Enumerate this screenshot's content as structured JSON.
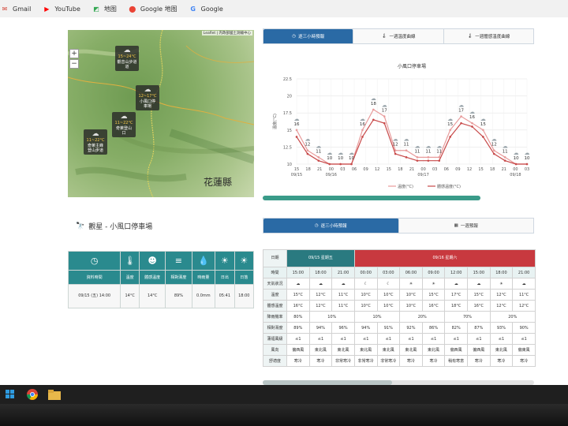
{
  "bookmarks": [
    {
      "label": "Gmail",
      "icon": "gmail-icon"
    },
    {
      "label": "YouTube",
      "icon": "youtube-icon"
    },
    {
      "label": "地图",
      "icon": "maps-icon"
    },
    {
      "label": "Google 地图",
      "icon": "google-maps-pin-icon"
    },
    {
      "label": "Google",
      "icon": "google-g-icon"
    }
  ],
  "map": {
    "attribution": "Leaflet | 内政部國土測繪中心",
    "county_label": "花蓮縣",
    "zoom_in": "+",
    "zoom_out": "−",
    "markers": [
      {
        "temp": "15~24°C",
        "name": "觀音山步道",
        "line3": "道"
      },
      {
        "temp": "12~17°C",
        "name": "小風口停",
        "line3": "車場"
      },
      {
        "temp": "11~22°C",
        "name": "奇萊登山",
        "line3": "口"
      },
      {
        "temp": "11~22°C",
        "name": "奇萊主峰",
        "line3": "登山步道"
      }
    ]
  },
  "chart_tabs": [
    "逐三小時預報",
    "一週溫度曲線",
    "一週體感溫度曲線"
  ],
  "chart_data": {
    "type": "line",
    "title": "小風口停車場",
    "ylabel": "溫度(°C)",
    "ylim": [
      10,
      22.5
    ],
    "y_ticks": [
      "22.5",
      "20",
      "17.5",
      "15",
      "12.5",
      "10"
    ],
    "x_ticks": [
      "15",
      "18",
      "21",
      "00",
      "03",
      "06",
      "09",
      "12",
      "15",
      "18",
      "21",
      "00",
      "03",
      "06",
      "09",
      "12",
      "15",
      "18",
      "21",
      "00",
      "03"
    ],
    "x_dates": [
      "09/15",
      "09/16",
      "09/17",
      "09/18"
    ],
    "legend": [
      "溫度(°C)",
      "體感溫度(°C)"
    ],
    "point_labels": [
      "16",
      "12",
      "11",
      "10",
      "10",
      "10",
      "16",
      "18",
      "17",
      "12",
      "11",
      "11",
      "11",
      "11",
      "15",
      "17",
      "16",
      "15",
      "12",
      "11",
      "10",
      "10"
    ],
    "series": [
      {
        "name": "溫度(°C)",
        "color": "#e89b9b",
        "values": [
          15,
          12,
          11,
          10,
          10,
          10,
          15,
          18,
          17,
          12,
          12,
          11,
          11,
          11,
          15,
          17,
          16,
          15,
          12,
          11,
          10,
          10
        ]
      },
      {
        "name": "體感溫度(°C)",
        "color": "#c84a4a",
        "values": [
          14,
          11.5,
          10.5,
          10,
          10,
          10,
          14,
          16.5,
          16,
          11.5,
          11,
          10.5,
          10.5,
          10.5,
          14,
          16,
          15.5,
          14,
          11.5,
          10.5,
          10,
          10
        ]
      }
    ]
  },
  "station": {
    "title": "觀星 - 小風口停車場",
    "headers": [
      "資料時間",
      "溫度",
      "體感溫度",
      "相對濕度",
      "時雨量",
      "日出",
      "日落"
    ],
    "icons": [
      "clock-icon",
      "thermometer-icon",
      "feel-temp-icon",
      "humidity-icon",
      "raindrop-icon",
      "sunrise-icon",
      "sunset-icon"
    ],
    "values": [
      "09/15 (五) 14:00",
      "14°C",
      "14°C",
      "89%",
      "0.0mm",
      "05:41",
      "18:00"
    ]
  },
  "forecast_tabs": [
    "逐三小時預報",
    "一週預報"
  ],
  "forecast": {
    "date_label": "日期",
    "day1": "09/15 星期五",
    "day2": "09/16 星期六",
    "rows": [
      {
        "label": "時間",
        "cells": [
          "15:00",
          "18:00",
          "21:00",
          "00:00",
          "03:00",
          "06:00",
          "09:00",
          "12:00",
          "15:00",
          "18:00",
          "21:00"
        ]
      },
      {
        "label": "天氣狀況",
        "cells": [
          "cloud",
          "cloud",
          "cloud",
          "moon",
          "moon",
          "sun",
          "sun",
          "cloud",
          "cloud",
          "sun",
          "cloud"
        ]
      },
      {
        "label": "溫度",
        "cells": [
          "15°C",
          "12°C",
          "11°C",
          "10°C",
          "10°C",
          "10°C",
          "15°C",
          "17°C",
          "15°C",
          "12°C",
          "11°C"
        ]
      },
      {
        "label": "體感溫度",
        "cells": [
          "16°C",
          "12°C",
          "11°C",
          "10°C",
          "10°C",
          "10°C",
          "16°C",
          "18°C",
          "16°C",
          "12°C",
          "12°C"
        ]
      },
      {
        "label": "降雨機率",
        "cells": [
          "80%",
          "10%",
          "10%",
          "20%",
          "70%",
          "20%"
        ]
      },
      {
        "label": "相對濕度",
        "cells": [
          "89%",
          "94%",
          "96%",
          "94%",
          "91%",
          "92%",
          "86%",
          "82%",
          "87%",
          "93%",
          "90%"
        ]
      },
      {
        "label": "蒲福風級",
        "cells": [
          "≤1",
          "≤1",
          "≤1",
          "≤1",
          "≤1",
          "≤1",
          "≤1",
          "≤1",
          "≤1",
          "≤1",
          "≤1"
        ]
      },
      {
        "label": "風向",
        "cells": [
          "偏西風",
          "東北風",
          "東北風",
          "東北風",
          "東北風",
          "東北風",
          "東北風",
          "偏西風",
          "偏西風",
          "東北風",
          "偏東風"
        ]
      },
      {
        "label": "舒適度",
        "cells": [
          "寒冷",
          "寒冷",
          "非常寒冷",
          "非常寒冷",
          "非常寒冷",
          "寒冷",
          "寒冷",
          "稍有寒意",
          "寒冷",
          "寒冷",
          "寒冷"
        ]
      }
    ]
  }
}
